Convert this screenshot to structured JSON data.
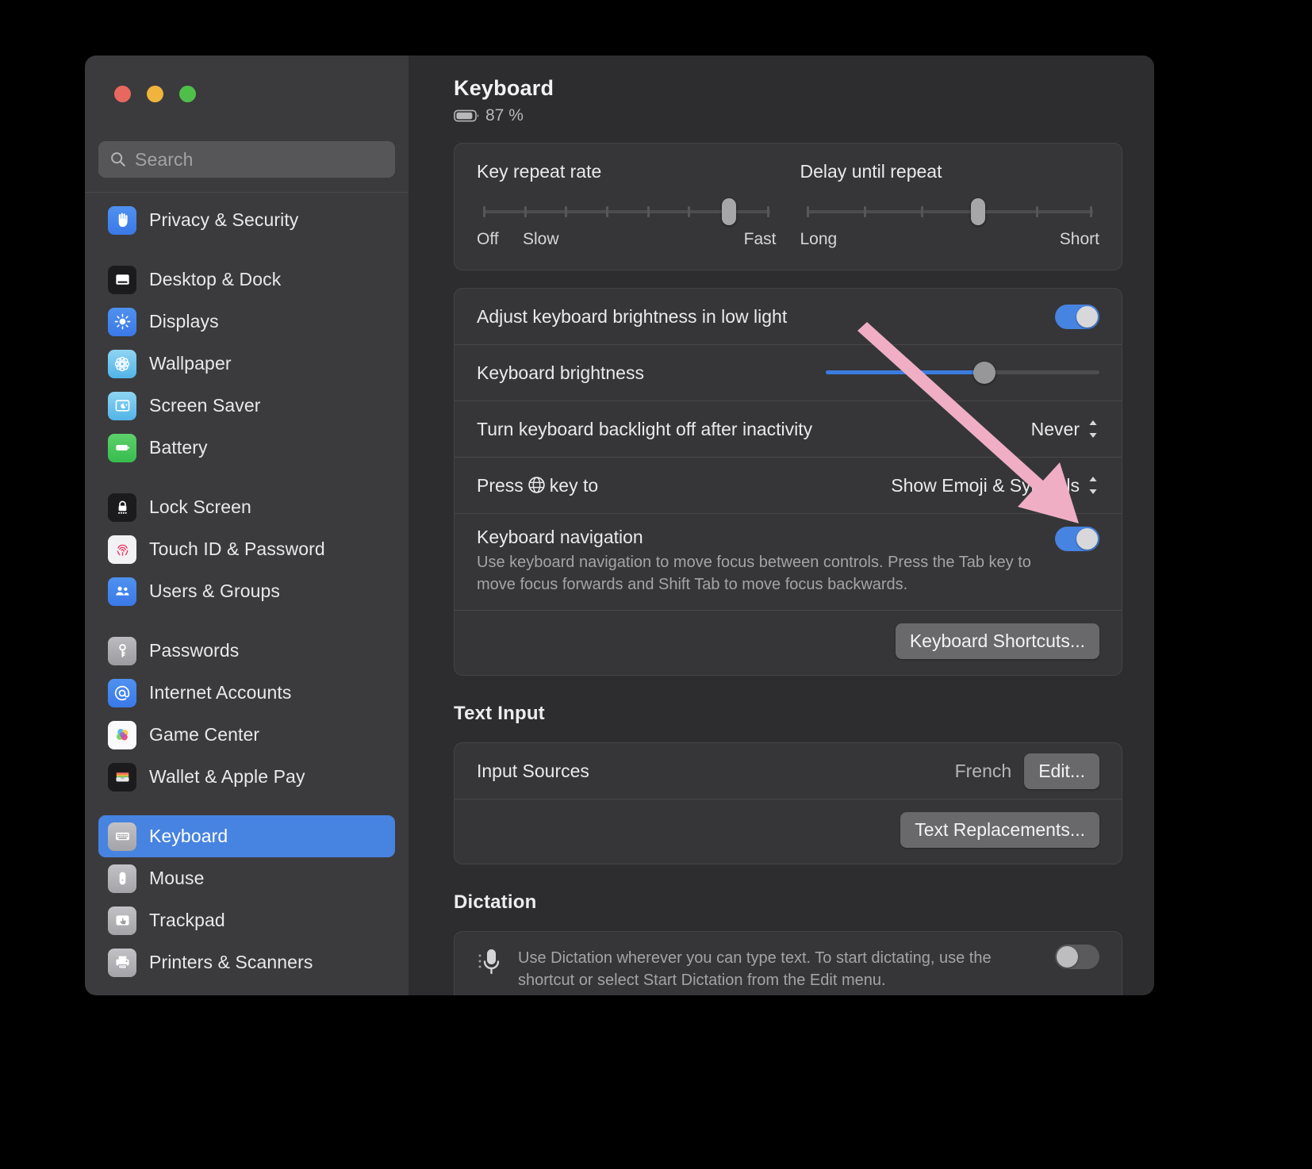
{
  "window": {
    "traffic_lights": [
      "close",
      "minimize",
      "zoom"
    ],
    "search": {
      "placeholder": "Search",
      "value": ""
    }
  },
  "sidebar": {
    "groups": [
      {
        "items": [
          {
            "label": "Privacy & Security",
            "icon": "hand-raised-icon",
            "selected": false
          }
        ]
      },
      {
        "items": [
          {
            "label": "Desktop & Dock",
            "icon": "desktop-dock-icon",
            "selected": false
          },
          {
            "label": "Displays",
            "icon": "brightness-sun-icon",
            "selected": false
          },
          {
            "label": "Wallpaper",
            "icon": "wallpaper-flower-icon",
            "selected": false
          },
          {
            "label": "Screen Saver",
            "icon": "screen-saver-moon-icon",
            "selected": false
          },
          {
            "label": "Battery",
            "icon": "battery-icon",
            "selected": false
          }
        ]
      },
      {
        "items": [
          {
            "label": "Lock Screen",
            "icon": "lock-icon",
            "selected": false
          },
          {
            "label": "Touch ID & Password",
            "icon": "fingerprint-icon",
            "selected": false
          },
          {
            "label": "Users & Groups",
            "icon": "users-group-icon",
            "selected": false
          }
        ]
      },
      {
        "items": [
          {
            "label": "Passwords",
            "icon": "key-icon",
            "selected": false
          },
          {
            "label": "Internet Accounts",
            "icon": "at-sign-icon",
            "selected": false
          },
          {
            "label": "Game Center",
            "icon": "game-center-bubbles-icon",
            "selected": false
          },
          {
            "label": "Wallet & Apple Pay",
            "icon": "wallet-icon",
            "selected": false
          }
        ]
      },
      {
        "items": [
          {
            "label": "Keyboard",
            "icon": "keyboard-icon",
            "selected": true
          },
          {
            "label": "Mouse",
            "icon": "mouse-icon",
            "selected": false
          },
          {
            "label": "Trackpad",
            "icon": "trackpad-icon",
            "selected": false
          },
          {
            "label": "Printers & Scanners",
            "icon": "printer-icon",
            "selected": false
          }
        ]
      }
    ]
  },
  "main": {
    "title": "Keyboard",
    "battery": {
      "icon": "battery-icon",
      "text": "87 %"
    },
    "sliders": {
      "key_repeat": {
        "title": "Key repeat rate",
        "ticks": 8,
        "value_index": 7,
        "label_left": "Off",
        "label_left2": "Slow",
        "label_right": "Fast"
      },
      "delay_until_repeat": {
        "title": "Delay until repeat",
        "ticks": 6,
        "value_index": 4,
        "label_left": "Long",
        "label_right": "Short"
      }
    },
    "rows": {
      "adjust_brightness": {
        "label": "Adjust keyboard brightness in low light",
        "toggle": "on"
      },
      "keyboard_brightness": {
        "label": "Keyboard brightness",
        "value_percent": 58
      },
      "backlight_off": {
        "label": "Turn keyboard backlight off after inactivity",
        "value": "Never"
      },
      "press_globe_key": {
        "label_before": "Press",
        "label_after": "key to",
        "icon": "globe-icon",
        "value": "Show Emoji & Symbols"
      },
      "keyboard_navigation": {
        "label": "Keyboard navigation",
        "description": "Use keyboard navigation to move focus between controls. Press the Tab key to move focus forwards and Shift Tab to move focus backwards.",
        "toggle": "on"
      }
    },
    "keyboard_shortcuts_button": "Keyboard Shortcuts...",
    "text_input": {
      "heading": "Text Input",
      "input_sources": {
        "label": "Input Sources",
        "value": "French",
        "button": "Edit..."
      },
      "text_replacements_button": "Text Replacements..."
    },
    "dictation": {
      "heading": "Dictation",
      "icon": "microphone-icon",
      "description": "Use Dictation wherever you can type text. To start dictating, use the shortcut or select Start Dictation from the Edit menu.",
      "toggle": "off"
    }
  },
  "annotation": {
    "type": "arrow",
    "color": "#efaec4",
    "points_to": "keyboard-navigation-toggle"
  },
  "colors": {
    "accent_blue": "#4783e0",
    "slider_blue": "#3b7ce0",
    "window_bg": "#2d2d2f",
    "sidebar_bg": "#3b3b3d",
    "card_bg": "#363638",
    "arrow_pink": "#efaec4"
  }
}
